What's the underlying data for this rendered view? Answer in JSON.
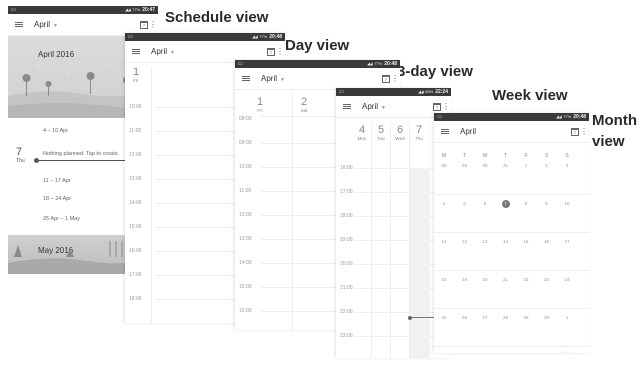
{
  "labels": {
    "schedule": "Schedule view",
    "day": "Day view",
    "three_day": "3-day view",
    "week": "Week view",
    "month_line1": "Month",
    "month_line2": "view"
  },
  "status": {
    "schedule": {
      "time": "20:47",
      "battery": "77%"
    },
    "day": {
      "time": "20:48",
      "battery": "77%"
    },
    "three_day": {
      "time": "20:48",
      "battery": "77%"
    },
    "week": {
      "time": "22:24",
      "battery": "83%"
    },
    "month": {
      "time": "20:48",
      "battery": "77%"
    }
  },
  "month_name": "April",
  "cal_icon_text": "7",
  "schedule": {
    "banner1": "April 2016",
    "range1": "4 – 10 Apr",
    "today_day": "7",
    "today_dow": "Thu",
    "nothing_planned": "Nothing planned. Tap to create.",
    "range2": "11 – 17 Apr",
    "range3": "18 – 24 Apr",
    "range4": "25 Apr – 1 May",
    "banner2": "May 2016"
  },
  "day": {
    "day_num": "1",
    "day_name": "Fri",
    "hours": [
      "10:00",
      "11:00",
      "12:00",
      "13:00",
      "14:00",
      "15:00",
      "16:00",
      "17:00",
      "18:00"
    ]
  },
  "three_day": {
    "days": [
      {
        "num": "1",
        "name": "Fri"
      },
      {
        "num": "2",
        "name": "Sat"
      }
    ],
    "top_hour": "08:00",
    "hours": [
      "09:00",
      "10:00",
      "11:00",
      "12:00",
      "13:00",
      "14:00",
      "15:00",
      "16:00"
    ]
  },
  "week": {
    "days": [
      {
        "num": "4",
        "name": "Mon"
      },
      {
        "num": "5",
        "name": "Tue"
      },
      {
        "num": "6",
        "name": "Wed"
      },
      {
        "num": "7",
        "name": "Thu"
      }
    ],
    "hours": [
      "16:00",
      "17:00",
      "18:00",
      "19:00",
      "20:00",
      "21:00",
      "22:00",
      "23:00"
    ]
  },
  "month": {
    "weekday_headers": [
      "M",
      "T",
      "W",
      "T",
      "F",
      "S",
      "S"
    ],
    "weeks": [
      [
        "28",
        "29",
        "30",
        "31",
        "1",
        "2",
        "3"
      ],
      [
        "4",
        "5",
        "6",
        "7",
        "8",
        "9",
        "10"
      ],
      [
        "11",
        "12",
        "13",
        "14",
        "15",
        "16",
        "17"
      ],
      [
        "18",
        "19",
        "20",
        "21",
        "22",
        "23",
        "24"
      ],
      [
        "25",
        "26",
        "27",
        "28",
        "29",
        "30",
        "1"
      ],
      [
        "2",
        "3",
        "4",
        "5",
        "6",
        "7",
        "8"
      ]
    ],
    "today": "7",
    "fab_label": "+"
  }
}
